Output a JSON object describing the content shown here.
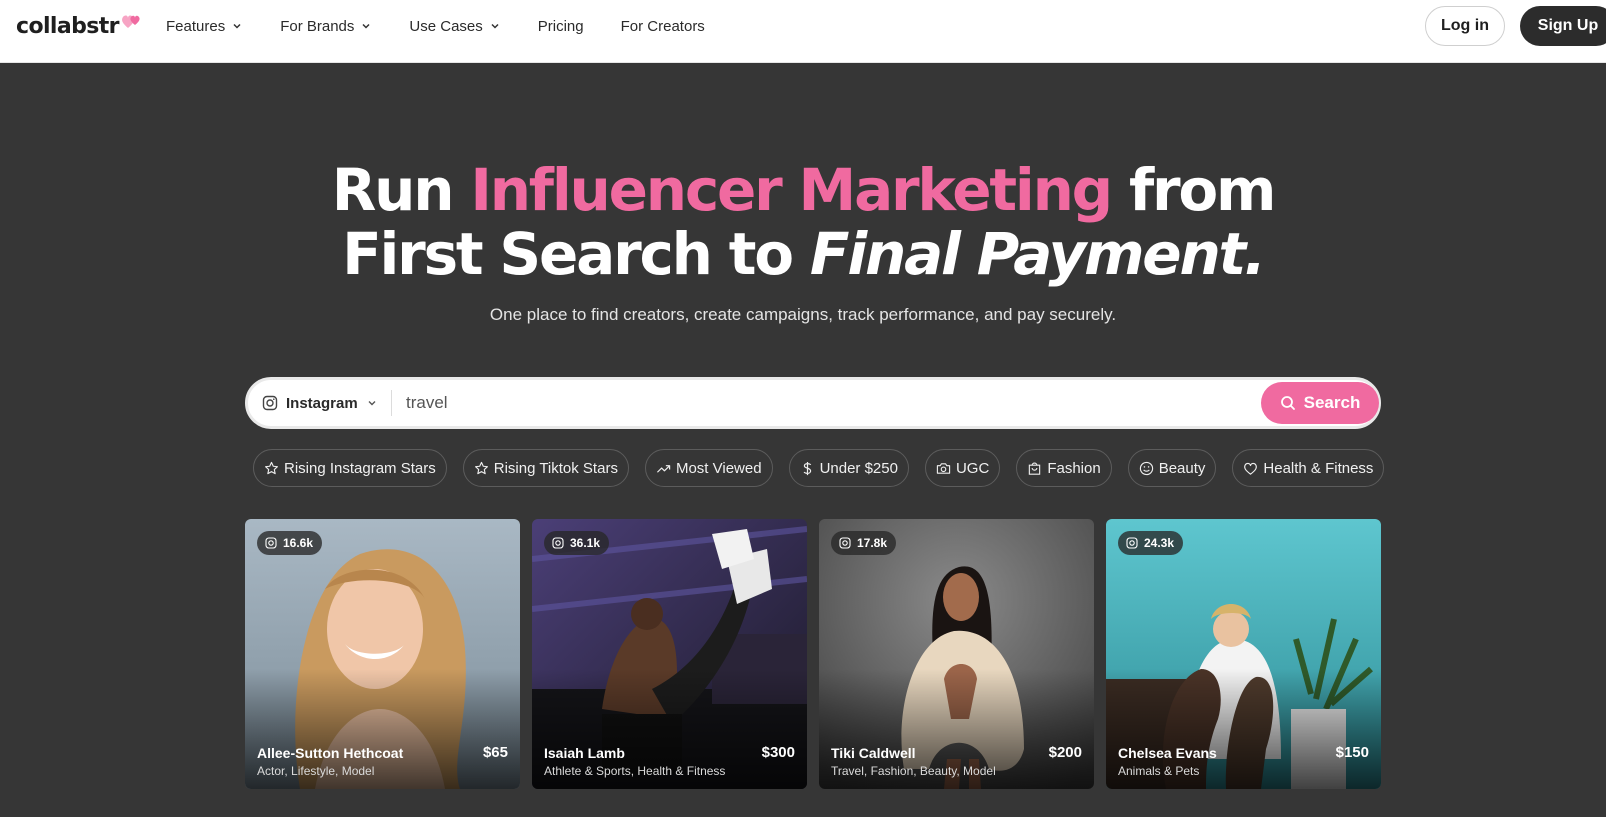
{
  "brand": {
    "name": "collabstr",
    "accent": "#f06aa0"
  },
  "nav": {
    "links": [
      {
        "label": "Features",
        "dropdown": true
      },
      {
        "label": "For Brands",
        "dropdown": true
      },
      {
        "label": "Use Cases",
        "dropdown": true
      },
      {
        "label": "Pricing",
        "dropdown": false
      },
      {
        "label": "For Creators",
        "dropdown": false
      }
    ],
    "login": "Log in",
    "signup": "Sign Up"
  },
  "hero": {
    "line1_start": "Run ",
    "line1_highlight": "Influencer Marketing",
    "line1_end": " from",
    "line2_start": "First Search to ",
    "line2_italic": "Final Payment.",
    "subtitle": "One place to find creators, create campaigns, track performance, and pay securely."
  },
  "search": {
    "platform": "Instagram",
    "platform_icon": "instagram-icon",
    "query": "travel",
    "button": "Search"
  },
  "chips": [
    {
      "label": "Rising Instagram Stars",
      "icon": "star-icon"
    },
    {
      "label": "Rising Tiktok Stars",
      "icon": "star-icon"
    },
    {
      "label": "Most Viewed",
      "icon": "trending-up-icon"
    },
    {
      "label": "Under $250",
      "icon": "dollar-icon"
    },
    {
      "label": "UGC",
      "icon": "camera-icon"
    },
    {
      "label": "Fashion",
      "icon": "bag-icon"
    },
    {
      "label": "Beauty",
      "icon": "smile-icon"
    },
    {
      "label": "Health & Fitness",
      "icon": "heart-icon"
    }
  ],
  "creators": [
    {
      "followers": "16.6k",
      "name": "Allee-Sutton Hethcoat",
      "categories": "Actor, Lifestyle, Model",
      "price": "$65"
    },
    {
      "followers": "36.1k",
      "name": "Isaiah Lamb",
      "categories": "Athlete & Sports, Health & Fitness",
      "price": "$300"
    },
    {
      "followers": "17.8k",
      "name": "Tiki Caldwell",
      "categories": "Travel, Fashion, Beauty, Model",
      "price": "$200"
    },
    {
      "followers": "24.3k",
      "name": "Chelsea Evans",
      "categories": "Animals & Pets",
      "price": "$150"
    }
  ]
}
